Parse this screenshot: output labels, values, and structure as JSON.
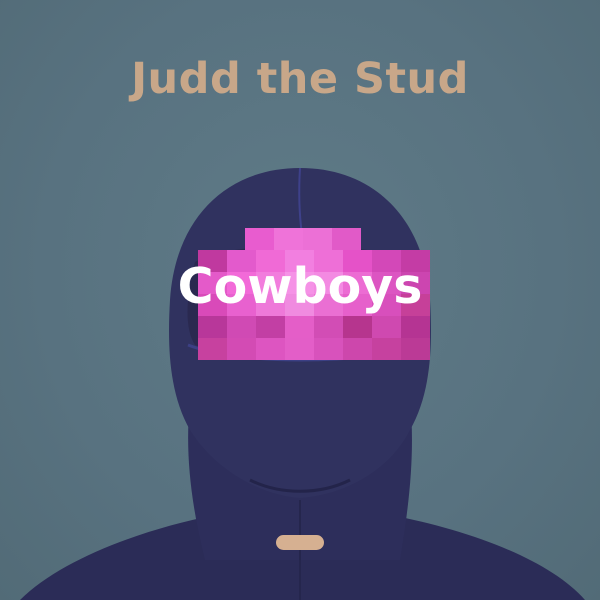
{
  "cover": {
    "artist": "Judd the Stud",
    "title": "Cowboys",
    "colors": {
      "background": "#5b7581",
      "artist_text": "#c8a789",
      "title_text": "#ffffff",
      "balaclava": "#2e2f5c",
      "pixelation": "#e64ac4",
      "tag": "#d6b091"
    },
    "icons": {
      "figure": "balaclava-figure",
      "censor": "pixelated-censor-bar"
    }
  }
}
